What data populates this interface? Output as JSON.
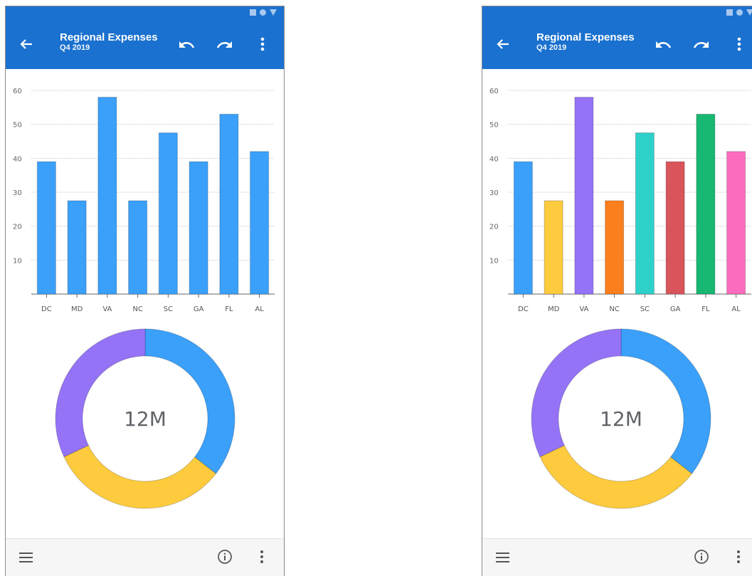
{
  "header": {
    "title": "Regional Expenses",
    "subtitle": "Q4 2019"
  },
  "icons": {
    "back": "arrow-left-icon",
    "undo": "undo-icon",
    "redo": "redo-icon",
    "more": "more-vertical-icon",
    "menu": "hamburger-menu-icon",
    "info": "info-circle-icon"
  },
  "colors": {
    "app_bar": "#1a71cf",
    "uniform_bar": "#3aa0fa",
    "donut_blue": "#3aa0fa",
    "donut_yellow": "#fdcb3d",
    "donut_purple": "#9473f7",
    "palette": [
      "#3aa0fa",
      "#fdcb3d",
      "#9473f7",
      "#fb7f1d",
      "#2ed1ca",
      "#d9555b",
      "#18b872",
      "#fc6cbe"
    ]
  },
  "chart_data": [
    {
      "type": "bar",
      "categories": [
        "DC",
        "MD",
        "VA",
        "NC",
        "SC",
        "GA",
        "FL",
        "AL"
      ],
      "values": [
        39,
        27.5,
        58,
        27.5,
        47.5,
        39,
        53,
        42
      ],
      "ylim": [
        0,
        60
      ],
      "yticks": [
        10,
        20,
        30,
        40,
        50,
        60
      ],
      "grid": true,
      "coloring": "uniform"
    },
    {
      "type": "pie",
      "variant": "donut",
      "center_label": "12M",
      "slices": [
        {
          "color": "#3aa0fa",
          "value": 0.355
        },
        {
          "color": "#fdcb3d",
          "value": 0.325
        },
        {
          "color": "#9473f7",
          "value": 0.32
        }
      ]
    },
    {
      "type": "bar",
      "categories": [
        "DC",
        "MD",
        "VA",
        "NC",
        "SC",
        "GA",
        "FL",
        "AL"
      ],
      "values": [
        39,
        27.5,
        58,
        27.5,
        47.5,
        39,
        53,
        42
      ],
      "ylim": [
        0,
        60
      ],
      "yticks": [
        10,
        20,
        30,
        40,
        50,
        60
      ],
      "grid": true,
      "coloring": "per-category"
    },
    {
      "type": "pie",
      "variant": "donut",
      "center_label": "12M",
      "slices": [
        {
          "color": "#3aa0fa",
          "value": 0.355
        },
        {
          "color": "#fdcb3d",
          "value": 0.325
        },
        {
          "color": "#9473f7",
          "value": 0.32
        }
      ]
    }
  ]
}
